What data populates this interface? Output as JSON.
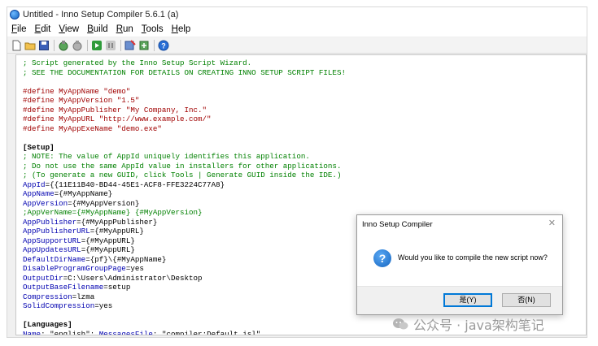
{
  "window": {
    "title": "Untitled - Inno Setup Compiler 5.6.1 (a)"
  },
  "menu": [
    {
      "label": "File",
      "mnemonic": "F",
      "rest": "ile"
    },
    {
      "label": "Edit",
      "mnemonic": "E",
      "rest": "dit"
    },
    {
      "label": "View",
      "mnemonic": "V",
      "rest": "iew"
    },
    {
      "label": "Build",
      "mnemonic": "B",
      "rest": "uild"
    },
    {
      "label": "Run",
      "mnemonic": "R",
      "rest": "un"
    },
    {
      "label": "Tools",
      "mnemonic": "T",
      "rest": "ools"
    },
    {
      "label": "Help",
      "mnemonic": "H",
      "rest": "elp"
    }
  ],
  "toolbar": {
    "icons": [
      "new-file-icon",
      "open-folder-icon",
      "save-icon",
      "compile-icon",
      "stop-compile-icon",
      "run-icon",
      "pause-icon",
      "wizard-icon",
      "target-icon",
      "help-icon"
    ]
  },
  "code": [
    [
      [
        "comment",
        "; Script generated by the Inno Setup Script Wizard."
      ]
    ],
    [
      [
        "comment",
        "; SEE THE DOCUMENTATION FOR DETAILS ON CREATING INNO SETUP SCRIPT FILES!"
      ]
    ],
    [],
    [
      [
        "directive",
        "#define MyAppName \"demo\""
      ]
    ],
    [
      [
        "directive",
        "#define MyAppVersion \"1.5\""
      ]
    ],
    [
      [
        "directive",
        "#define MyAppPublisher \"My Company, Inc.\""
      ]
    ],
    [
      [
        "directive",
        "#define MyAppURL \"http://www.example.com/\""
      ]
    ],
    [
      [
        "directive",
        "#define MyAppExeName \"demo.exe\""
      ]
    ],
    [],
    [
      [
        "section",
        "[Setup]"
      ]
    ],
    [
      [
        "comment",
        "; NOTE: The value of AppId uniquely identifies this application."
      ]
    ],
    [
      [
        "comment",
        "; Do not use the same AppId value in installers for other applications."
      ]
    ],
    [
      [
        "comment",
        "; (To generate a new GUID, click Tools | Generate GUID inside the IDE.)"
      ]
    ],
    [
      [
        "key",
        "AppId"
      ],
      [
        "default",
        "={{11E11B40-BD44-45E1-ACF8-FFE3224C77A8}"
      ]
    ],
    [
      [
        "key",
        "AppName"
      ],
      [
        "default",
        "={#MyAppName}"
      ]
    ],
    [
      [
        "key",
        "AppVersion"
      ],
      [
        "default",
        "={#MyAppVersion}"
      ]
    ],
    [
      [
        "comment",
        ";AppVerName={#MyAppName} {#MyAppVersion}"
      ]
    ],
    [
      [
        "key",
        "AppPublisher"
      ],
      [
        "default",
        "={#MyAppPublisher}"
      ]
    ],
    [
      [
        "key",
        "AppPublisherURL"
      ],
      [
        "default",
        "={#MyAppURL}"
      ]
    ],
    [
      [
        "key",
        "AppSupportURL"
      ],
      [
        "default",
        "={#MyAppURL}"
      ]
    ],
    [
      [
        "key",
        "AppUpdatesURL"
      ],
      [
        "default",
        "={#MyAppURL}"
      ]
    ],
    [
      [
        "key",
        "DefaultDirName"
      ],
      [
        "default",
        "={pf}\\{#MyAppName}"
      ]
    ],
    [
      [
        "key",
        "DisableProgramGroupPage"
      ],
      [
        "default",
        "=yes"
      ]
    ],
    [
      [
        "key",
        "OutputDir"
      ],
      [
        "default",
        "=C:\\Users\\Administrator\\Desktop"
      ]
    ],
    [
      [
        "key",
        "OutputBaseFilename"
      ],
      [
        "default",
        "=setup"
      ]
    ],
    [
      [
        "key",
        "Compression"
      ],
      [
        "default",
        "=lzma"
      ]
    ],
    [
      [
        "key",
        "SolidCompression"
      ],
      [
        "default",
        "=yes"
      ]
    ],
    [],
    [
      [
        "section",
        "[Languages]"
      ]
    ],
    [
      [
        "key",
        "Name"
      ],
      [
        "default",
        ": \"english\"; "
      ],
      [
        "key",
        "MessagesFile"
      ],
      [
        "default",
        ": \"compiler:Default.isl\""
      ]
    ]
  ],
  "dialog": {
    "title": "Inno Setup Compiler",
    "message": "Would you like to compile the new script now?",
    "yes_label": "是(Y)",
    "no_label": "否(N)"
  },
  "watermark": {
    "text": "公众号 · java架构笔记"
  },
  "colors": {
    "comment": "#008000",
    "directive": "#a00000",
    "key": "#0000b0",
    "accent": "#0078d7"
  }
}
